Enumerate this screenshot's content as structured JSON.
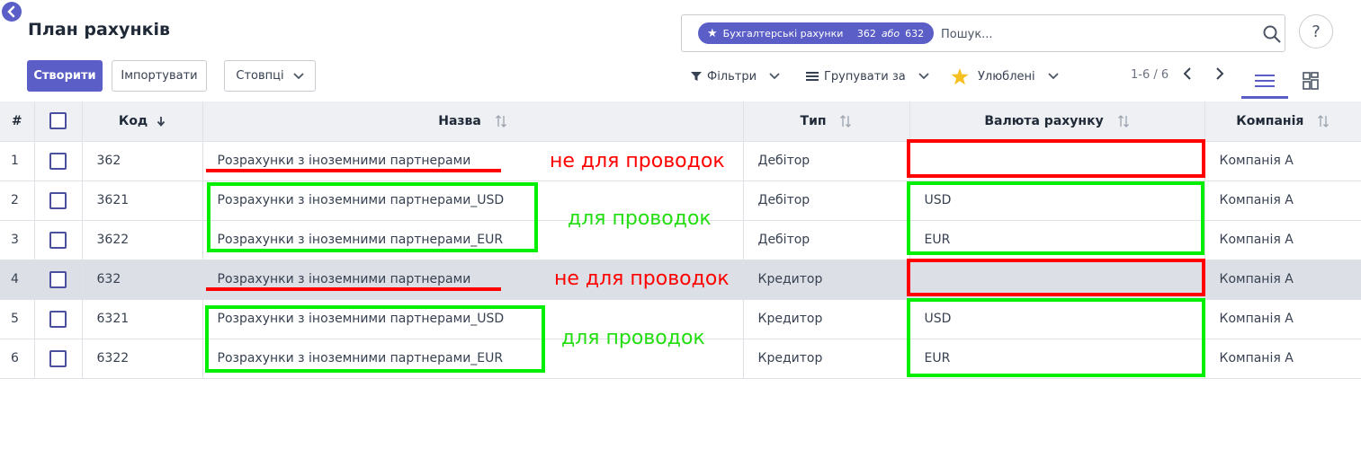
{
  "header": {
    "title": "План рахунків",
    "create_label": "Створити",
    "import_label": "Імпортувати",
    "columns_label": "Стовпці"
  },
  "search": {
    "facet_label": "Бухгалтерські рахунки",
    "facet_value_a": "362",
    "facet_or": "або",
    "facet_value_b": "632",
    "placeholder": "Пошук..."
  },
  "toolbar": {
    "filters_label": "Фільтри",
    "groupby_label": "Групувати за",
    "favorites_label": "Улюблені",
    "pager_text": "1-6 / 6",
    "help_label": "?"
  },
  "table": {
    "headers": {
      "num": "#",
      "code": "Код",
      "name": "Назва",
      "type": "Тип",
      "currency": "Валюта рахунку",
      "company": "Компанія"
    },
    "rows": [
      {
        "num": "1",
        "code": "362",
        "name": "Розрахунки з іноземними партнерами",
        "type": "Дебітор",
        "currency": "",
        "company": "Компанія А"
      },
      {
        "num": "2",
        "code": "3621",
        "name": "Розрахунки з іноземними партнерами_USD",
        "type": "Дебітор",
        "currency": "USD",
        "company": "Компанія А"
      },
      {
        "num": "3",
        "code": "3622",
        "name": "Розрахунки з іноземними партнерами_EUR",
        "type": "Дебітор",
        "currency": "EUR",
        "company": "Компанія А"
      },
      {
        "num": "4",
        "code": "632",
        "name": "Розрахунки з іноземними партнерами",
        "type": "Кредитор",
        "currency": "",
        "company": "Компанія А"
      },
      {
        "num": "5",
        "code": "6321",
        "name": "Розрахунки з іноземними партнерами_USD",
        "type": "Кредитор",
        "currency": "USD",
        "company": "Компанія А"
      },
      {
        "num": "6",
        "code": "6322",
        "name": "Розрахунки з іноземними партнерами_EUR",
        "type": "Кредитор",
        "currency": "EUR",
        "company": "Компанія А"
      }
    ]
  },
  "annotations": {
    "not_for_postings_1": "не для проводок",
    "for_postings_1": "для проводок",
    "not_for_postings_2": "не для проводок",
    "for_postings_2": "для проводок"
  },
  "colors": {
    "accent": "#5b5ec6",
    "annotation_red": "#ff0000",
    "annotation_green": "#00ee00",
    "selected_row": "#dcdfe5"
  }
}
